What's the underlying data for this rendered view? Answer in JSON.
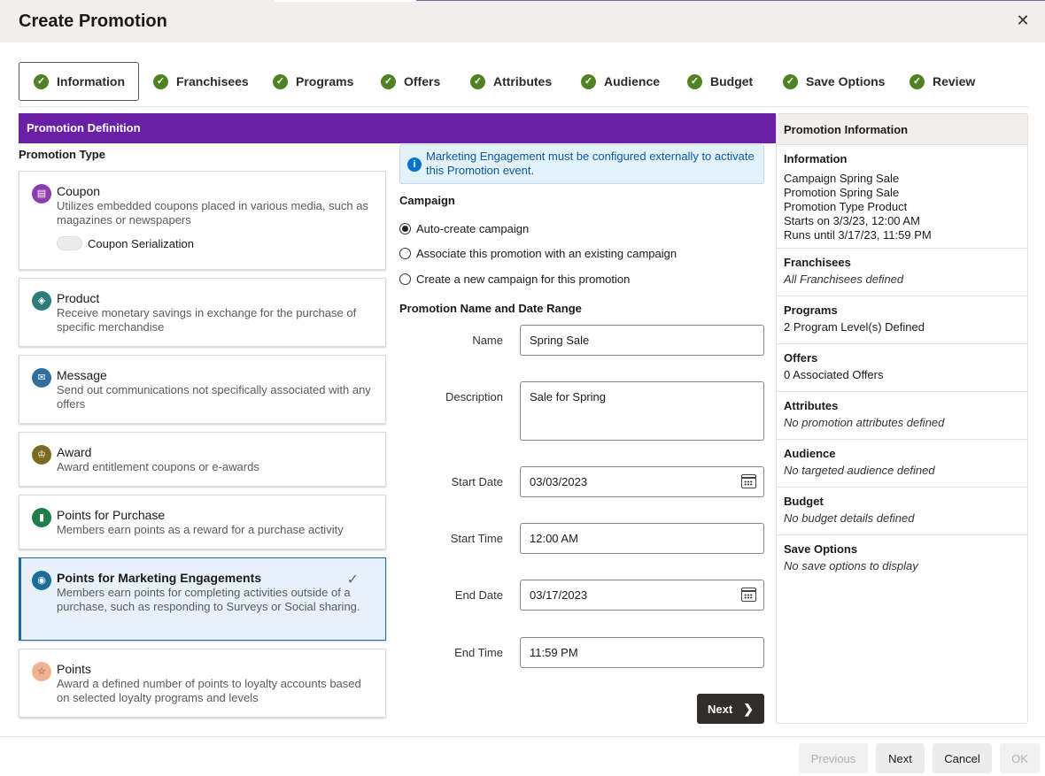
{
  "dialog": {
    "title": "Create Promotion",
    "close_icon": "close-icon"
  },
  "steps": [
    {
      "label": "Information",
      "active": true
    },
    {
      "label": "Franchisees"
    },
    {
      "label": "Programs"
    },
    {
      "label": "Offers"
    },
    {
      "label": "Attributes"
    },
    {
      "label": "Audience"
    },
    {
      "label": "Budget"
    },
    {
      "label": "Save Options"
    },
    {
      "label": "Review"
    }
  ],
  "definition": {
    "header": "Promotion Definition",
    "type_title": "Promotion Type",
    "types": [
      {
        "title": "Coupon",
        "desc": "Utilizes embedded coupons placed in various media, such as magazines or newspapers",
        "icon": "coupon-icon",
        "color": "#8b3fae",
        "toggle_label": "Coupon Serialization"
      },
      {
        "title": "Product",
        "desc": "Receive monetary savings in exchange for the purchase of specific merchandise",
        "icon": "cube-icon",
        "color": "#2e7b7b"
      },
      {
        "title": "Message",
        "desc": "Send out communications not specifically associated with any offers",
        "icon": "envelope-icon",
        "color": "#2f6e9e"
      },
      {
        "title": "Award",
        "desc": "Award entitlement coupons or e-awards",
        "icon": "trophy-icon",
        "color": "#7c6a22"
      },
      {
        "title": "Points for Purchase",
        "desc": "Members earn points as a reward for a purchase activity",
        "icon": "points-icon",
        "color": "#1f7d4a"
      },
      {
        "title": "Points for Marketing Engagements",
        "desc": "Members earn points for completing activities outside of a purchase, such as responding to Surveys or Social sharing.",
        "icon": "eye-icon",
        "color": "#1c6d98",
        "selected": true
      },
      {
        "title": "Points",
        "desc": "Award a defined number of points to loyalty accounts based on selected loyalty programs and levels",
        "icon": "star-icon",
        "color": "#f0b391"
      }
    ]
  },
  "info_banner": "Marketing Engagement must be configured externally to activate this Promotion event.",
  "campaign": {
    "title": "Campaign",
    "options": [
      {
        "label": "Auto-create campaign",
        "selected": true
      },
      {
        "label": "Associate this promotion with an existing campaign"
      },
      {
        "label": "Create a new campaign for this promotion"
      }
    ]
  },
  "name_date": {
    "title": "Promotion Name and Date Range",
    "name_label": "Name",
    "name_value": "Spring Sale",
    "desc_label": "Description",
    "desc_value": "Sale for Spring",
    "start_date_label": "Start Date",
    "start_date_value": "03/03/2023",
    "start_time_label": "Start Time",
    "start_time_value": "12:00 AM",
    "end_date_label": "End Date",
    "end_date_value": "03/17/2023",
    "end_time_label": "End Time",
    "end_time_value": "11:59 PM",
    "next_label": "Next"
  },
  "side": {
    "header": "Promotion Information",
    "sections": [
      {
        "title": "Information",
        "lines": [
          "Campaign Spring Sale",
          "Promotion Spring Sale",
          "Promotion Type Product",
          "Starts on 3/3/23, 12:00 AM",
          "Runs until 3/17/23, 11:59 PM"
        ]
      },
      {
        "title": "Franchisees",
        "lines": [
          "All Franchisees defined"
        ],
        "italic": true
      },
      {
        "title": "Programs",
        "lines": [
          "2 Program Level(s) Defined"
        ]
      },
      {
        "title": "Offers",
        "lines": [
          "0 Associated Offers"
        ]
      },
      {
        "title": "Attributes",
        "lines": [
          "No promotion attributes defined"
        ],
        "italic": true
      },
      {
        "title": "Audience",
        "lines": [
          "No targeted audience defined"
        ],
        "italic": true
      },
      {
        "title": "Budget",
        "lines": [
          "No budget details defined"
        ],
        "italic": true
      },
      {
        "title": "Save Options",
        "lines": [
          "No save options to display"
        ],
        "italic": true
      }
    ]
  },
  "footer": {
    "previous": "Previous",
    "next": "Next",
    "cancel": "Cancel",
    "ok": "OK"
  }
}
